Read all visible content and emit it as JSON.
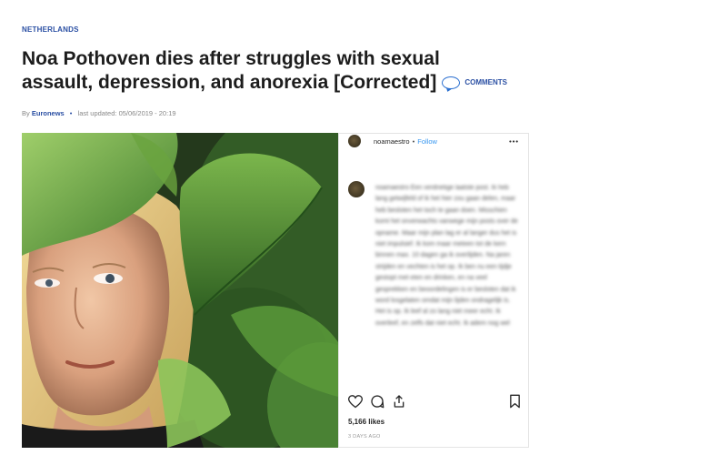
{
  "article": {
    "kicker": "NETHERLANDS",
    "headline": "Noa Pothoven dies after struggles with sexual assault, depression, and anorexia [Corrected]",
    "comments_label": "COMMENTS",
    "byline_prefix": "By",
    "source": "Euronews",
    "updated": "last updated: 05/06/2019 - 20:19"
  },
  "instagram": {
    "username": "noamaestro",
    "separator": "•",
    "follow_label": "Follow",
    "more_label": "•••",
    "caption": "noamaestro Een verdrietige laatste post. Ik heb lang getwijfeld of ik het hier zou gaan delen, maar heb besloten het toch te gaan doen. Misschien komt het onverwachts vanwege mijn posts over de opname. Maar mijn plan lag er al langer dus het is niet impulsief. Ik kom maar meteen tot de kern binnen max. 10 dagen ga ik overlijden. Na jaren strijden en vechten is het op. Ik ben nu een tijdje gestopt met eten en drinken, en na veel gesprekken en beoordelingen is er besloten dat ik word losgelaten omdat mijn lijden ondragelijk is. Het is op. Ik leef al zo lang niet meer echt. Ik overleef, en zelfs dat niet echt. Ik adem nog wel",
    "likes": "5,166 likes",
    "posted": "3 DAYS AGO"
  },
  "colors": {
    "link_blue": "#2a4fa3",
    "instagram_blue": "#3897f0",
    "headline": "#1d1d1d"
  }
}
